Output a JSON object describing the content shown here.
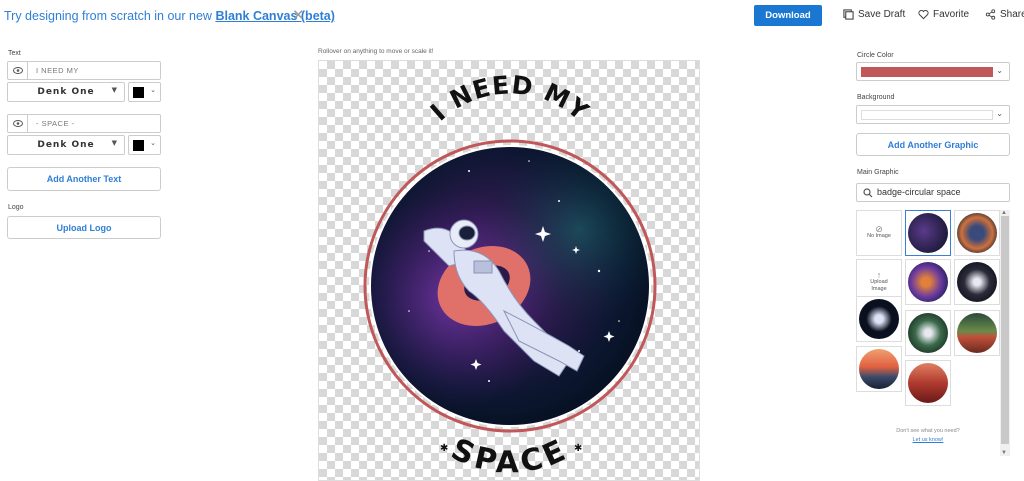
{
  "topbar": {
    "promo_prefix": "Try designing from scratch in our new ",
    "promo_link": "Blank Canvas (beta)",
    "download_label": "Download",
    "save_draft_label": "Save Draft",
    "favorite_label": "Favorite",
    "share_label": "Share"
  },
  "left": {
    "text_section_label": "Text",
    "text_fields": [
      {
        "value": "I NEED MY",
        "font": "Denk One",
        "color": "#000000"
      },
      {
        "value": "- SPACE -",
        "font": "Denk One",
        "color": "#000000"
      }
    ],
    "add_text_label": "Add Another Text",
    "logo_section_label": "Logo",
    "upload_logo_label": "Upload Logo"
  },
  "canvas": {
    "note": "Rollover on anything to move or scale it!",
    "top_text": "I NEED MY",
    "bottom_text": "SPACE",
    "circle_color": "#c0585a"
  },
  "right": {
    "circle_color_label": "Circle Color",
    "circle_color_value": "#c0585a",
    "background_label": "Background",
    "add_graphic_label": "Add Another Graphic",
    "main_graphic_label": "Main Graphic",
    "search_value": "badge-circular space",
    "no_image_label": "No Image",
    "upload_image_label_1": "Upload",
    "upload_image_label_2": "Image",
    "help_text": "Don't see what you need?",
    "help_link": "Let us know!"
  }
}
